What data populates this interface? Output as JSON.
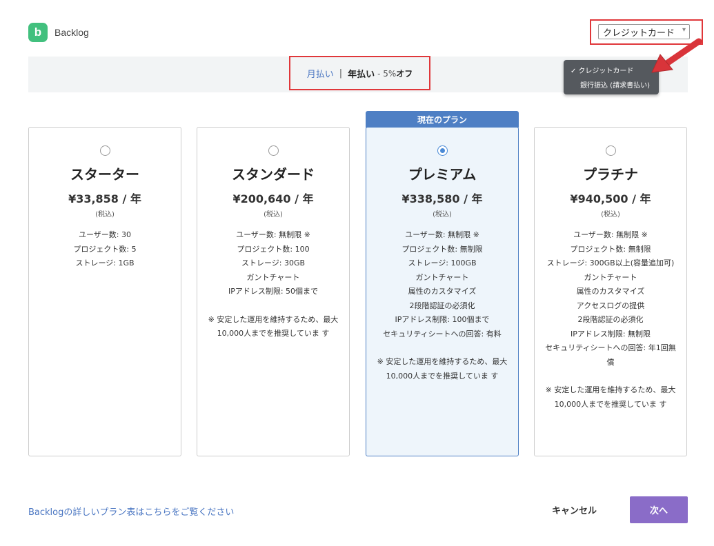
{
  "header": {
    "logo_letter": "b",
    "app_name": "Backlog"
  },
  "payment": {
    "selected": "クレジットカード",
    "options": [
      {
        "label": "クレジットカード",
        "checked": true
      },
      {
        "label": "銀行振込 (請求書払い)",
        "checked": false
      }
    ]
  },
  "billing": {
    "monthly_label": "月払い",
    "separator": "|",
    "yearly_label": "年払い",
    "discount_prefix": " - 5%",
    "discount_suffix": "オフ"
  },
  "current_plan_tag": "現在のプラン",
  "plans": [
    {
      "name": "スターター",
      "price": "¥33,858 / 年",
      "tax": "(税込)",
      "selected": false,
      "features": [
        "ユーザー数: 30",
        "プロジェクト数: 5",
        "ストレージ: 1GB"
      ]
    },
    {
      "name": "スタンダード",
      "price": "¥200,640 / 年",
      "tax": "(税込)",
      "selected": false,
      "features": [
        "ユーザー数: 無制限 ※",
        "プロジェクト数: 100",
        "ストレージ: 30GB",
        "ガントチャート",
        "IPアドレス制限: 50個まで"
      ],
      "note": "※ 安定した運用を維持するため、最大10,000人までを推奨していま す"
    },
    {
      "name": "プレミアム",
      "price": "¥338,580 / 年",
      "tax": "(税込)",
      "selected": true,
      "features": [
        "ユーザー数: 無制限 ※",
        "プロジェクト数: 無制限",
        "ストレージ: 100GB",
        "ガントチャート",
        "属性のカスタマイズ",
        "2段階認証の必須化",
        "IPアドレス制限: 100個まで",
        "セキュリティシートへの回答: 有料"
      ],
      "note": "※ 安定した運用を維持するため、最大10,000人までを推奨していま す"
    },
    {
      "name": "プラチナ",
      "price": "¥940,500 / 年",
      "tax": "(税込)",
      "selected": false,
      "features": [
        "ユーザー数: 無制限 ※",
        "プロジェクト数: 無制限",
        "ストレージ: 300GB以上(容量追加可)",
        "ガントチャート",
        "属性のカスタマイズ",
        "アクセスログの提供",
        "2段階認証の必須化",
        "IPアドレス制限: 無制限",
        "セキュリティシートへの回答: 年1回無償"
      ],
      "note": "※ 安定した運用を維持するため、最大10,000人までを推奨していま す"
    }
  ],
  "footer": {
    "plan_link": "Backlogの詳しいプラン表はこちらをご覧ください",
    "cancel": "キャンセル",
    "next": "次へ"
  },
  "colors": {
    "accent_blue": "#4e7fc4",
    "next_purple": "#8a6cc8",
    "highlight_red": "#e0373a",
    "logo_green": "#42c07e"
  }
}
